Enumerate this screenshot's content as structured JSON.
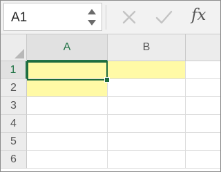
{
  "formula_bar": {
    "name_box": "A1",
    "fx_label": "fx",
    "icons": [
      "cancel-icon",
      "enter-checkmark-icon",
      "insert-function-icon"
    ]
  },
  "grid": {
    "columns": [
      "A",
      "B"
    ],
    "rows": [
      "1",
      "2",
      "3",
      "4",
      "5",
      "6"
    ],
    "selected_cell": "A1",
    "highlighted_cells": [
      "A1",
      "B1",
      "A2"
    ],
    "cell_values": {}
  },
  "colors": {
    "accent": "#217346",
    "highlight_fill": "#fffaa6",
    "header_bg": "#ececec"
  }
}
